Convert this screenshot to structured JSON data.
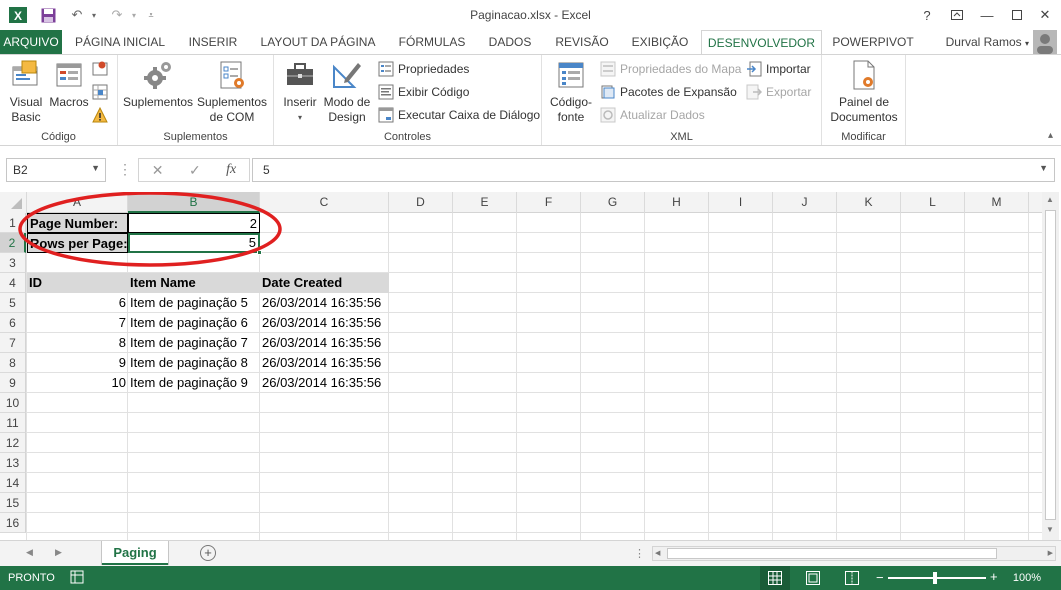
{
  "window": {
    "title": "Paginacao.xlsx - Excel",
    "app_icon": "excel-icon",
    "user": "Durval Ramos"
  },
  "qat": {
    "save": "save-icon",
    "undo": "undo-icon",
    "redo": "redo-icon",
    "customize": "customize-qat-icon"
  },
  "tabs": [
    "ARQUIVO",
    "PÁGINA INICIAL",
    "INSERIR",
    "LAYOUT DA PÁGINA",
    "FÓRMULAS",
    "DADOS",
    "REVISÃO",
    "EXIBIÇÃO",
    "DESENVOLVEDOR",
    "POWERPIVOT"
  ],
  "active_tab": "DESENVOLVEDOR",
  "ribbon": {
    "codigo": {
      "label": "Código",
      "visual_basic": "Visual Basic",
      "macros": "Macros"
    },
    "suplementos": {
      "label": "Suplementos",
      "suplementos": "Suplementos",
      "suplementos_com": "Suplementos de COM"
    },
    "controles": {
      "label": "Controles",
      "inserir": "Inserir",
      "modo_design": "Modo de Design",
      "propriedades": "Propriedades",
      "exibir_codigo": "Exibir Código",
      "executar_caixa": "Executar Caixa de Diálogo"
    },
    "xml": {
      "label": "XML",
      "codigo_fonte": "Código-fonte",
      "propriedades_mapa": "Propriedades do Mapa",
      "pacotes_expansao": "Pacotes de Expansão",
      "atualizar_dados": "Atualizar Dados",
      "importar": "Importar",
      "exportar": "Exportar"
    },
    "modificar": {
      "label": "Modificar",
      "painel_documentos": "Painel de Documentos"
    }
  },
  "formula_bar": {
    "name_box": "B2",
    "content": "5",
    "cancel": "✕",
    "enter": "✓",
    "fx": "fx"
  },
  "columns": [
    "A",
    "B",
    "C",
    "D",
    "E",
    "F",
    "G",
    "H",
    "I",
    "J",
    "K",
    "L",
    "M"
  ],
  "selected_column": "B",
  "rows": [
    "1",
    "2",
    "3",
    "4",
    "5",
    "6",
    "7",
    "8",
    "9",
    "10",
    "11",
    "12",
    "13",
    "14",
    "15",
    "16"
  ],
  "selected_row": "2",
  "cells": {
    "a1": "Page Number:",
    "b1": "2",
    "a2": "Rows per Page:",
    "b2": "5",
    "headers": [
      "ID",
      "Item Name",
      "Date Created"
    ],
    "data": [
      [
        "6",
        "Item de paginação 5",
        "26/03/2014 16:35:56"
      ],
      [
        "7",
        "Item de paginação 6",
        "26/03/2014 16:35:56"
      ],
      [
        "8",
        "Item de paginação 7",
        "26/03/2014 16:35:56"
      ],
      [
        "9",
        "Item de paginação 8",
        "26/03/2014 16:35:56"
      ],
      [
        "10",
        "Item de paginação 9",
        "26/03/2014 16:35:56"
      ]
    ]
  },
  "sheet_tab": "Paging",
  "status": {
    "mode": "PRONTO",
    "zoom": "100%"
  },
  "colors": {
    "accent": "#217346",
    "annotation": "#e02020"
  }
}
